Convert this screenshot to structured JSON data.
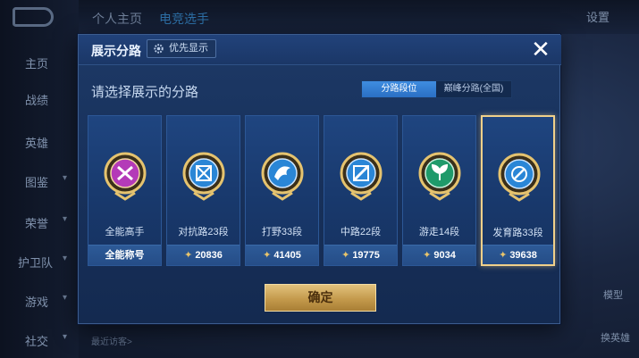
{
  "background": {
    "top_tabs": [
      "个人主页",
      "电竞选手"
    ],
    "settings_label": "设置",
    "side_nav": [
      {
        "label": "主页"
      },
      {
        "label": "战绩"
      },
      {
        "label": "英雄"
      },
      {
        "label": "图鉴"
      },
      {
        "label": "荣誉"
      },
      {
        "label": "护卫队"
      },
      {
        "label": "游戏"
      },
      {
        "label": "社交"
      }
    ],
    "recent_visitors": "最近访客>",
    "model_label": "模型",
    "switch_hero_label": "换英雄"
  },
  "dialog": {
    "title": "展示分路",
    "priority_label": "优先显示",
    "close_glyph": "✕",
    "prompt": "请选择展示的分路",
    "tabs": [
      {
        "label": "分路段位",
        "active": true
      },
      {
        "label": "巅峰分路(全国)",
        "active": false
      }
    ],
    "cards": [
      {
        "name": "全能高手",
        "score": "全能称号",
        "icon": "all-round-medal-icon",
        "color": "#b43ab8",
        "selected": false
      },
      {
        "name": "对抗路23段",
        "score": "20836",
        "icon": "clash-lane-medal-icon",
        "color": "#2a86d6",
        "selected": false
      },
      {
        "name": "打野33段",
        "score": "41405",
        "icon": "jungle-medal-icon",
        "color": "#2a86d6",
        "selected": false
      },
      {
        "name": "中路22段",
        "score": "19775",
        "icon": "mid-lane-medal-icon",
        "color": "#2a86d6",
        "selected": false
      },
      {
        "name": "游走14段",
        "score": "9034",
        "icon": "roam-medal-icon",
        "color": "#1f9a6a",
        "selected": false
      },
      {
        "name": "发育路33段",
        "score": "39638",
        "icon": "farm-lane-medal-icon",
        "color": "#2a86d6",
        "selected": true
      }
    ],
    "confirm_label": "确定"
  },
  "colors": {
    "gold": "#e8c46c",
    "selected_border": "#f0d08a",
    "tab_active": "#3f8de0"
  }
}
